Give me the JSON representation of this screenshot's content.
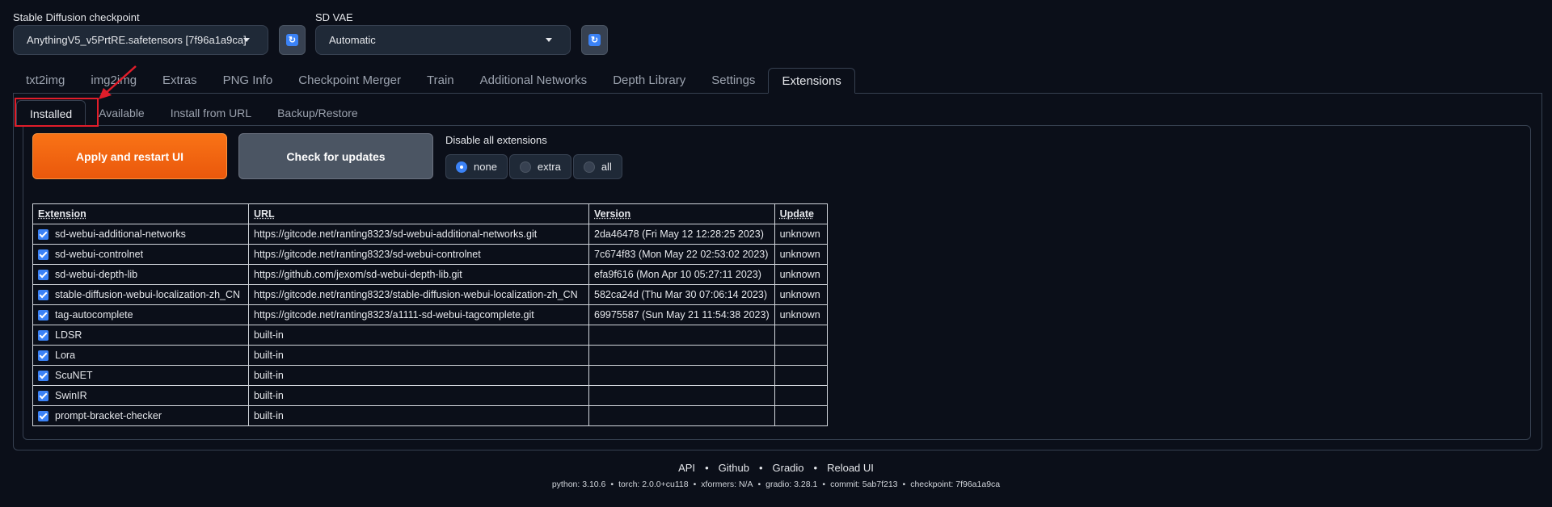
{
  "checkpoint": {
    "label": "Stable Diffusion checkpoint",
    "value": "AnythingV5_v5PrtRE.safetensors [7f96a1a9ca]"
  },
  "vae": {
    "label": "SD VAE",
    "value": "Automatic"
  },
  "tabs": [
    {
      "label": "txt2img"
    },
    {
      "label": "img2img"
    },
    {
      "label": "Extras"
    },
    {
      "label": "PNG Info"
    },
    {
      "label": "Checkpoint Merger"
    },
    {
      "label": "Train"
    },
    {
      "label": "Additional Networks"
    },
    {
      "label": "Depth Library"
    },
    {
      "label": "Settings"
    },
    {
      "label": "Extensions"
    }
  ],
  "active_tab": "Extensions",
  "subtabs": [
    {
      "label": "Installed"
    },
    {
      "label": "Available"
    },
    {
      "label": "Install from URL"
    },
    {
      "label": "Backup/Restore"
    }
  ],
  "active_subtab": "Installed",
  "buttons": {
    "apply": "Apply and restart UI",
    "check": "Check for updates"
  },
  "disable": {
    "label": "Disable all extensions",
    "options": [
      "none",
      "extra",
      "all"
    ],
    "selected": "none"
  },
  "table": {
    "headers": [
      "Extension",
      "URL",
      "Version",
      "Update"
    ],
    "rows": [
      {
        "name": "sd-webui-additional-networks",
        "url": "https://gitcode.net/ranting8323/sd-webui-additional-networks.git",
        "version": "2da46478 (Fri May 12 12:28:25 2023)",
        "update": "unknown",
        "checked": true
      },
      {
        "name": "sd-webui-controlnet",
        "url": "https://gitcode.net/ranting8323/sd-webui-controlnet",
        "version": "7c674f83 (Mon May 22 02:53:02 2023)",
        "update": "unknown",
        "checked": true
      },
      {
        "name": "sd-webui-depth-lib",
        "url": "https://github.com/jexom/sd-webui-depth-lib.git",
        "version": "efa9f616 (Mon Apr 10 05:27:11 2023)",
        "update": "unknown",
        "checked": true
      },
      {
        "name": "stable-diffusion-webui-localization-zh_CN",
        "url": "https://gitcode.net/ranting8323/stable-diffusion-webui-localization-zh_CN",
        "version": "582ca24d (Thu Mar 30 07:06:14 2023)",
        "update": "unknown",
        "checked": true
      },
      {
        "name": "tag-autocomplete",
        "url": "https://gitcode.net/ranting8323/a1111-sd-webui-tagcomplete.git",
        "version": "69975587 (Sun May 21 11:54:38 2023)",
        "update": "unknown",
        "checked": true
      },
      {
        "name": "LDSR",
        "url": "built-in",
        "version": "",
        "update": "",
        "checked": true
      },
      {
        "name": "Lora",
        "url": "built-in",
        "version": "",
        "update": "",
        "checked": true
      },
      {
        "name": "ScuNET",
        "url": "built-in",
        "version": "",
        "update": "",
        "checked": true
      },
      {
        "name": "SwinIR",
        "url": "built-in",
        "version": "",
        "update": "",
        "checked": true
      },
      {
        "name": "prompt-bracket-checker",
        "url": "built-in",
        "version": "",
        "update": "",
        "checked": true
      }
    ]
  },
  "footer": {
    "links": [
      "API",
      "Github",
      "Gradio",
      "Reload UI"
    ],
    "info": [
      "python: 3.10.6",
      "torch: 2.0.0+cu118",
      "xformers: N/A",
      "gradio: 3.28.1",
      "commit: 5ab7f213",
      "checkpoint: 7f96a1a9ca"
    ]
  },
  "colors": {
    "background": "#0b0f19",
    "accent": "#f97316",
    "checkbox": "#3b82f6",
    "highlight": "#e11d2a"
  }
}
